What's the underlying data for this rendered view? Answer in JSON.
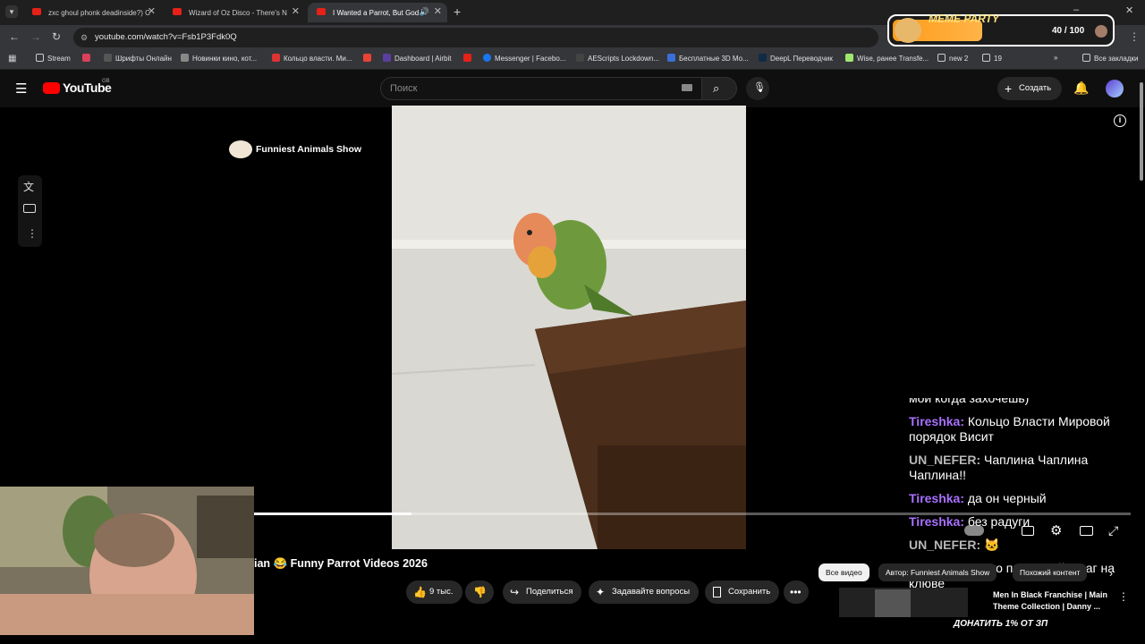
{
  "browser": {
    "tabs": [
      {
        "title": "zxc ghoul phonk deadinside?) C",
        "active": false
      },
      {
        "title": "Wizard of Oz Disco - There's N",
        "active": false
      },
      {
        "title": "I Wanted a Parrot, But God",
        "active": true
      }
    ],
    "url": "youtube.com/watch?v=Fsb1P3Fdk0Q",
    "bookmarks": [
      "Stream",
      "Шрифты Онлайн",
      "Новинки кино, кот...",
      "Кольцо власти. Ми...",
      "Dashboard | Airbit",
      "Messenger | Facebo...",
      "AEScripts Lockdown...",
      "Бесплатные 3D Мо...",
      "DeepL Переводчик",
      "Wise, ранее Transfe...",
      "new 2",
      "19",
      "Все закладки"
    ]
  },
  "youtube": {
    "logo_text": "YouTube",
    "logo_region": "GB",
    "search_placeholder": "Поиск",
    "create_label": "Создать"
  },
  "player": {
    "channel_badge": "Funniest Animals Show",
    "progress_fraction": 0.18
  },
  "video": {
    "title_fragment": "ian",
    "title_emoji": "😂",
    "title_rest": "Funny Parrot Videos 2026",
    "like_count": "9 тыс.",
    "share_label": "Поделиться",
    "ask_label": "Задавайте вопросы",
    "save_label": "Сохранить"
  },
  "chips": [
    "Все видео",
    "Автор: Funniest Animals Show",
    "Похожий контент"
  ],
  "recommended": {
    "title_line1": "Men In Black Franchise | Main",
    "title_line2": "Theme Collection | Danny ..."
  },
  "chat": {
    "top_partial": "мои когда захочешь)",
    "messages": [
      {
        "user": "Tireshka:",
        "text": " Кольцо Власти Мировой порядок Висит",
        "color": "#a970ff"
      },
      {
        "user": "UN_NEFER:",
        "text": " Чаплина Чаплина Чаплина!!",
        "color": "#b7b7b7"
      },
      {
        "user": "Tireshka:",
        "text": " да он черный",
        "color": "#a970ff"
      },
      {
        "user": "Tireshka:",
        "text": " без радуги",
        "color": "#a970ff"
      },
      {
        "user": "UN_NEFER:",
        "text": " 🐱",
        "color": "#b7b7b7"
      },
      {
        "user": "Tireshka:",
        "text": " у него пиратский флаг на клюве",
        "color": "#a970ff"
      }
    ]
  },
  "overlay": {
    "title": "MEME PARTY",
    "progress_text": "40 / 100",
    "progress_fraction": 0.4,
    "donate_text": "ДОНАТИТЬ 1% ОТ ЗП"
  }
}
